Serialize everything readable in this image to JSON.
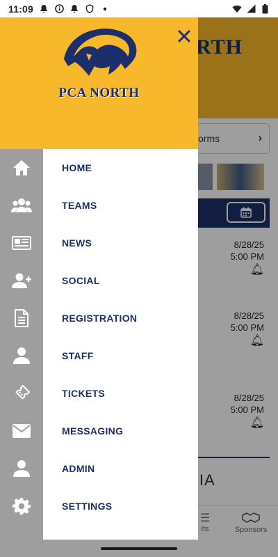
{
  "status_bar": {
    "time": "11:09",
    "left_icons": [
      "notification-bell-icon",
      "info-icon",
      "notification-bell-icon",
      "shield-icon",
      "dot-icon"
    ],
    "right_icons": [
      "wifi-icon",
      "signal-icon",
      "battery-icon"
    ]
  },
  "background": {
    "title_fragment": "RTH",
    "forms_fragment": "orms",
    "events": [
      {
        "date": "8/28/25",
        "time": "5:00 PM"
      },
      {
        "date": "8/28/25",
        "time": "5:00 PM"
      },
      {
        "date": "8/28/25",
        "time": "5:00 PM"
      }
    ],
    "media_fragment": "DIA",
    "tabs": [
      {
        "label": "lts",
        "icon": "list-icon"
      },
      {
        "label": "Sponsors",
        "icon": "handshake-icon"
      }
    ]
  },
  "drawer": {
    "brand": "PCA NORTH",
    "logo_icon": "lion-mascot-logo",
    "close_icon": "close-icon",
    "colors": {
      "header": "#f8b82b",
      "navy": "#1d2f6b",
      "rail": "#9e9e9e"
    },
    "menu": [
      {
        "label": "HOME",
        "icon": "home-icon"
      },
      {
        "label": "TEAMS",
        "icon": "group-icon"
      },
      {
        "label": "NEWS",
        "icon": "newspaper-icon"
      },
      {
        "label": "SOCIAL",
        "icon": "add-person-icon"
      },
      {
        "label": "REGISTRATION",
        "icon": "document-icon"
      },
      {
        "label": "STAFF",
        "icon": "person-icon"
      },
      {
        "label": "TICKETS",
        "icon": "ticket-icon"
      },
      {
        "label": "MESSAGING",
        "icon": "envelope-icon"
      },
      {
        "label": "ADMIN",
        "icon": "person-icon"
      },
      {
        "label": "SETTINGS",
        "icon": "gear-icon"
      }
    ]
  }
}
